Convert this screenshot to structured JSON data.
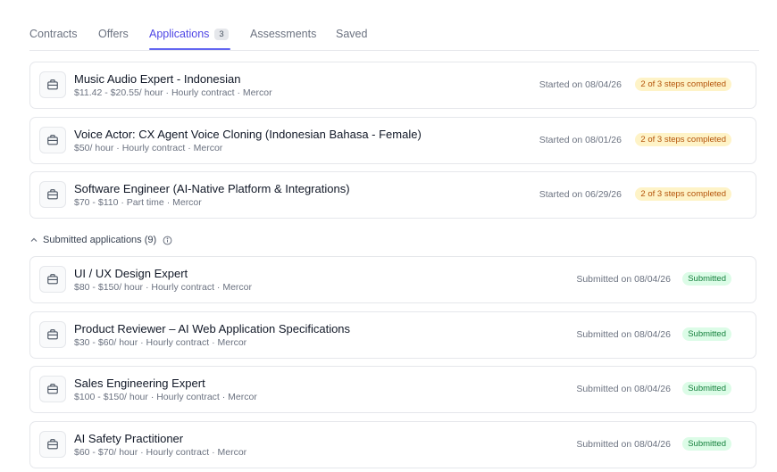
{
  "tabs": [
    {
      "label": "Contracts"
    },
    {
      "label": "Offers"
    },
    {
      "label": "Applications",
      "count": "3"
    },
    {
      "label": "Assessments"
    },
    {
      "label": "Saved"
    }
  ],
  "in_progress": [
    {
      "title": "Music Audio Expert - Indonesian",
      "meta": "$11.42 - $20.55/ hour · Hourly contract · Mercor",
      "date": "Started on 08/04/26",
      "status": "2 of 3 steps completed"
    },
    {
      "title": "Voice Actor: CX Agent Voice Cloning (Indonesian Bahasa - Female)",
      "meta": "$50/ hour · Hourly contract · Mercor",
      "date": "Started on 08/01/26",
      "status": "2 of 3 steps completed"
    },
    {
      "title": "Software Engineer (AI-Native Platform & Integrations)",
      "meta": "$70 - $110 · Part time · Mercor",
      "date": "Started on 06/29/26",
      "status": "2 of 3 steps completed"
    }
  ],
  "submitted_section": {
    "label": "Submitted applications (9)"
  },
  "submitted": [
    {
      "title": "UI / UX Design Expert",
      "meta": "$80 - $150/ hour · Hourly contract · Mercor",
      "date": "Submitted on 08/04/26",
      "status": "Submitted"
    },
    {
      "title": "Product Reviewer – AI Web Application Specifications",
      "meta": "$30 - $60/ hour · Hourly contract · Mercor",
      "date": "Submitted on 08/04/26",
      "status": "Submitted"
    },
    {
      "title": "Sales Engineering Expert",
      "meta": "$100 - $150/ hour · Hourly contract · Mercor",
      "date": "Submitted on 08/04/26",
      "status": "Submitted"
    },
    {
      "title": "AI Safety Practitioner",
      "meta": "$60 - $70/ hour · Hourly contract · Mercor",
      "date": "Submitted on 08/04/26",
      "status": "Submitted"
    }
  ],
  "colors": {
    "accent": "#4f46e5",
    "progress_bg": "#fef3c7",
    "submitted_bg": "#dcfce7"
  }
}
